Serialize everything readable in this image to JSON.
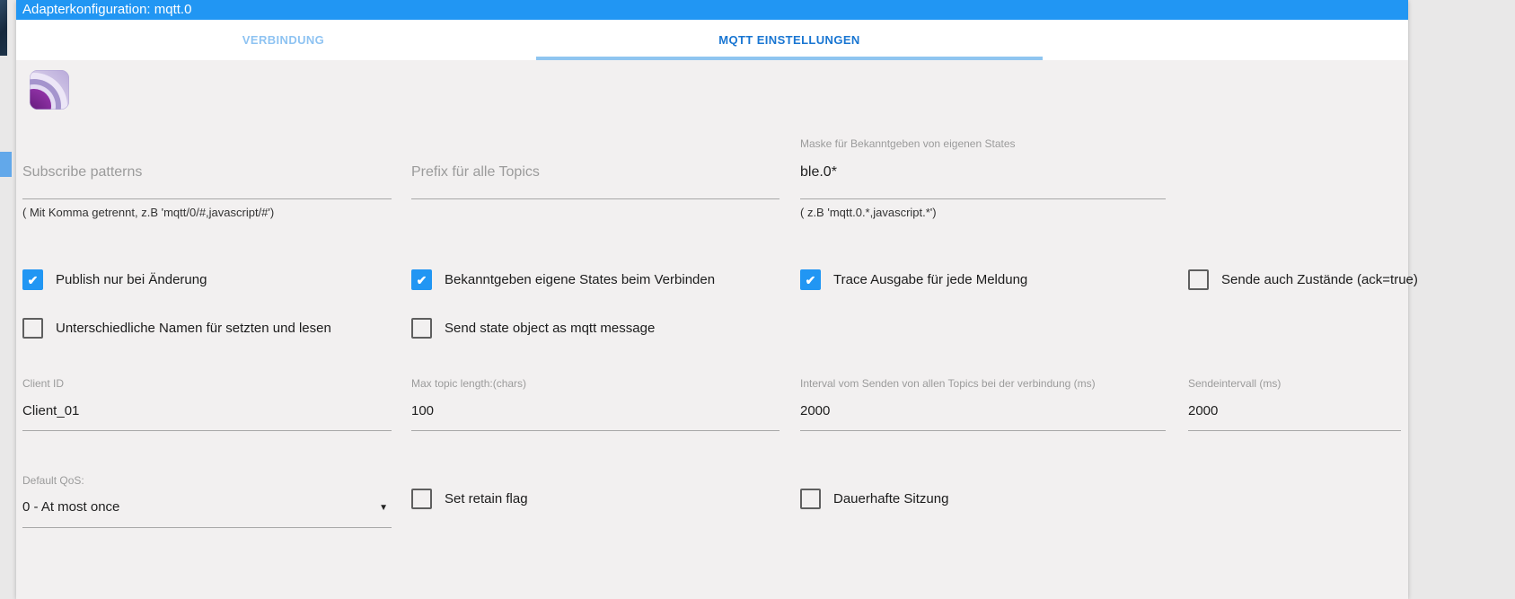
{
  "window": {
    "title": "Adapterkonfiguration: mqtt.0"
  },
  "tabs": [
    {
      "label": "VERBINDUNG",
      "active": false
    },
    {
      "label": "MQTT EINSTELLUNGEN",
      "active": true
    }
  ],
  "colors": {
    "titlebar": "#2196f3",
    "accent": "#2196f3",
    "tab_active_text": "#1976d2",
    "tab_indicator": "#8fc5f0",
    "content_background": "#f2f0f0"
  },
  "icons": {
    "caret_down": "▼",
    "check": "✔"
  },
  "fields_row1": [
    {
      "placeholder": "Subscribe patterns",
      "value": "",
      "hint": "( Mit Komma getrennt, z.B 'mqtt/0/#,javascript/#')"
    },
    {
      "placeholder": "Prefix für alle Topics",
      "value": ""
    },
    {
      "label": "Maske für Bekanntgeben von eigenen States",
      "value": "ble.0*",
      "hint": "( z.B 'mqtt.0.*,javascript.*')"
    }
  ],
  "checkboxes_row1": [
    {
      "label": "Publish nur bei Änderung",
      "checked": true
    },
    {
      "label": "Bekanntgeben eigene States beim Verbinden",
      "checked": true
    },
    {
      "label": "Trace Ausgabe für jede Meldung",
      "checked": true
    },
    {
      "label": "Sende auch Zustände (ack=true)",
      "checked": false
    }
  ],
  "checkboxes_row2": [
    {
      "label": "Unterschiedliche Namen für setzten und lesen",
      "checked": false
    },
    {
      "label": "Send state object as mqtt message",
      "checked": false
    }
  ],
  "fields_row2": [
    {
      "label": "Client ID",
      "value": "Client_01"
    },
    {
      "label": "Max topic length:(chars)",
      "value": "100"
    },
    {
      "label": "Interval vom Senden von allen Topics bei der verbindung (ms)",
      "value": "2000"
    },
    {
      "label": "Sendeintervall (ms)",
      "value": "2000"
    }
  ],
  "qos_select": {
    "label": "Default QoS:",
    "value": "0 - At most once"
  },
  "checkboxes_row3": [
    {
      "label": "Set retain flag",
      "checked": false
    },
    {
      "label": "Dauerhafte Sitzung",
      "checked": false
    }
  ]
}
